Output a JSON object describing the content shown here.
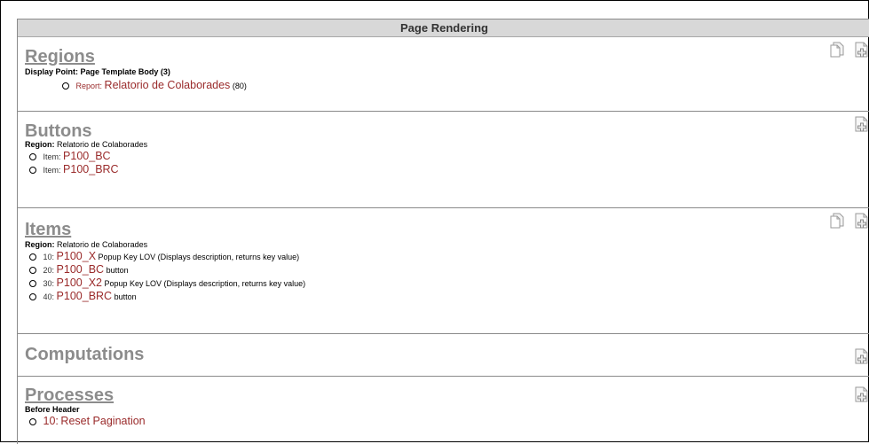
{
  "panel": {
    "title": "Page Rendering"
  },
  "regions": {
    "title": "Regions",
    "display_point_label": "Display Point: Page Template Body (3)",
    "items": [
      {
        "prefix": "Report:",
        "name": "Relatorio de Colaborades",
        "suffix": "(80)"
      }
    ]
  },
  "buttons": {
    "title": "Buttons",
    "region_label": "Region:",
    "region_value": "Relatorio de Colaborades",
    "items": [
      {
        "prefix": "Item:",
        "name": "P100_BC"
      },
      {
        "prefix": "Item:",
        "name": "P100_BRC"
      }
    ]
  },
  "items": {
    "title": "Items",
    "region_label": "Region:",
    "region_value": "Relatorio de Colaborades",
    "items": [
      {
        "prefix": "10:",
        "name": "P100_X",
        "desc": "Popup Key LOV (Displays description, returns key value)"
      },
      {
        "prefix": "20:",
        "name": "P100_BC",
        "desc": "button"
      },
      {
        "prefix": "30:",
        "name": "P100_X2",
        "desc": "Popup Key LOV (Displays description, returns key value)"
      },
      {
        "prefix": "40:",
        "name": "P100_BRC",
        "desc": "button"
      }
    ]
  },
  "computations": {
    "title": "Computations"
  },
  "processes": {
    "title": "Processes",
    "point_label": "Before Header",
    "items": [
      {
        "prefix": "10:",
        "name": "Reset Pagination"
      }
    ]
  },
  "icons": {
    "copy": "copy-icon",
    "create": "create-icon"
  }
}
